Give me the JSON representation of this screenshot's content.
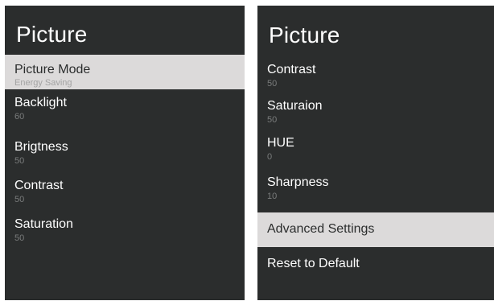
{
  "left_panel": {
    "title": "Picture",
    "items": [
      {
        "label": "Picture Mode",
        "value": "Energy Saving",
        "selected": true
      },
      {
        "label": "Backlight",
        "value": "60",
        "selected": false
      },
      {
        "label": "Brigtness",
        "value": "50",
        "selected": false
      },
      {
        "label": "Contrast",
        "value": "50",
        "selected": false
      },
      {
        "label": "Saturation",
        "value": "50",
        "selected": false
      }
    ]
  },
  "right_panel": {
    "title": "Picture",
    "items": [
      {
        "label": "Contrast",
        "value": "50",
        "selected": false
      },
      {
        "label": "Saturaion",
        "value": "50",
        "selected": false
      },
      {
        "label": "HUE",
        "value": "0",
        "selected": false
      },
      {
        "label": "Sharpness",
        "value": "10",
        "selected": false
      },
      {
        "label": "Advanced Settings",
        "selected": true
      },
      {
        "label": "Reset to Default",
        "selected": false
      }
    ]
  },
  "colors": {
    "panel_background": "#2b2d2d",
    "selected_background": "#dcdada",
    "text": "#ffffff",
    "value_text": "#7a7c7c"
  }
}
